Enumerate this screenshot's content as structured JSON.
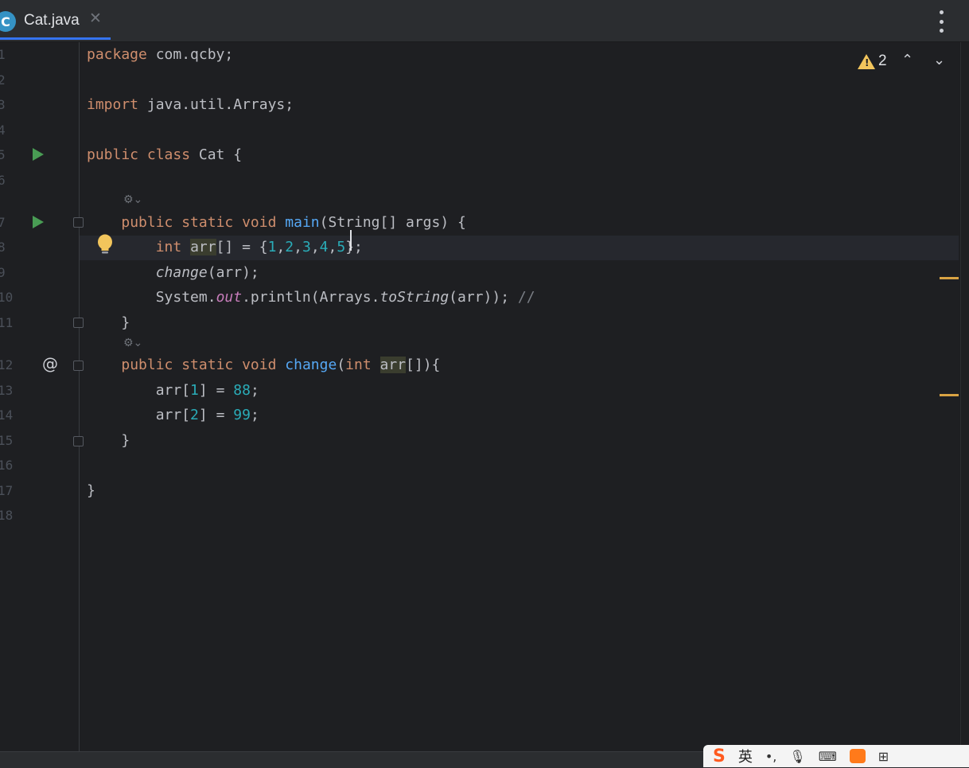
{
  "tab": {
    "file_name": "Cat.java",
    "file_icon_letter": "C",
    "close_glyph": "✕"
  },
  "toolbar": {
    "menu_icon": "more-vertical-icon"
  },
  "inspection": {
    "warning_count": "2",
    "prev_glyph": "⌃",
    "next_glyph": "⌄"
  },
  "gutter": {
    "line_numbers": [
      "1",
      "2",
      "3",
      "4",
      "5",
      "6",
      "7",
      "8",
      "9",
      "10",
      "11",
      "12",
      "13",
      "14",
      "15",
      "16",
      "17",
      "18"
    ],
    "at_glyph": "@",
    "hint_glyph": "⚙⌄"
  },
  "code": {
    "line1": [
      "package",
      " com.qcby;"
    ],
    "line3": [
      "import",
      " java.util.Arrays;"
    ],
    "line5": [
      "public class",
      " Cat {"
    ],
    "line7": [
      "    ",
      "public static void",
      " ",
      "main",
      "(String[] args) {"
    ],
    "line8": [
      "        ",
      "int",
      " ",
      "arr",
      "[] = {",
      "1",
      ",",
      "2",
      ",",
      "3",
      ",",
      "4",
      ",",
      "5",
      "};"
    ],
    "line9": [
      "        ",
      "change",
      "(arr);"
    ],
    "line10": [
      "        System.",
      "out",
      ".println(Arrays.",
      "toString",
      "(arr)); ",
      "//"
    ],
    "line11": [
      "    }"
    ],
    "line12": [
      "    ",
      "public static void",
      " ",
      "change",
      "(",
      "int",
      " ",
      "arr",
      "[]){"
    ],
    "line13": [
      "        arr[",
      "1",
      "] = ",
      "88",
      ";"
    ],
    "line14": [
      "        arr[",
      "2",
      "] = ",
      "99",
      ";"
    ],
    "line15": [
      "    }"
    ],
    "line17": [
      "}"
    ]
  },
  "ime_bar": {
    "logo": "S",
    "language": "英",
    "icons": [
      "punctuation-icon",
      "microphone-icon",
      "keyboard-icon",
      "skin-icon",
      "toolbox-icon"
    ],
    "punct_glyph": "•,",
    "mic_glyph": "🎙",
    "kbd_glyph": "⌨",
    "grid_glyph": "⊞"
  },
  "colors": {
    "keyword": "#cf8e6d",
    "function": "#56a8f5",
    "number": "#2aacb8",
    "field": "#c77dbb",
    "accent": "#3574f0",
    "warning": "#f2c55c"
  }
}
